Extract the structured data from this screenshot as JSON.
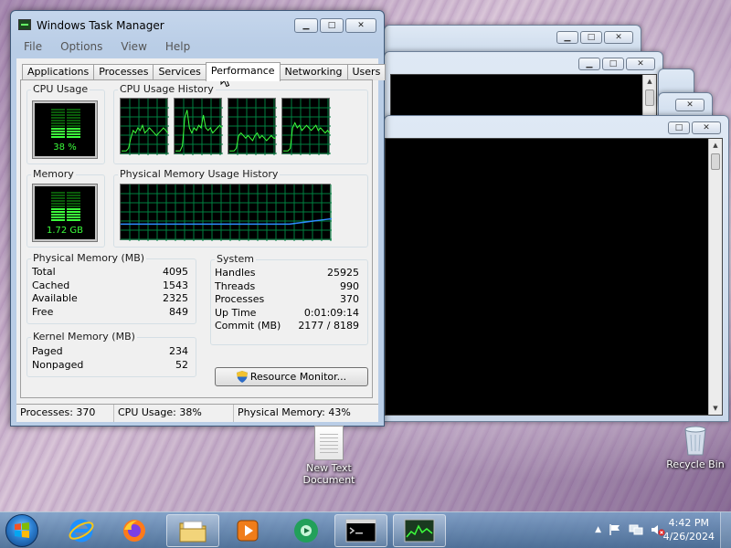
{
  "task_manager": {
    "title": "Windows Task Manager",
    "menu": [
      "File",
      "Options",
      "View",
      "Help"
    ],
    "tabs": [
      "Applications",
      "Processes",
      "Services",
      "Performance",
      "Networking",
      "Users"
    ],
    "active_tab": "Performance",
    "performance": {
      "cpu_usage_title": "CPU Usage",
      "cpu_usage_value": "38 %",
      "cpu_usage_fraction": 0.38,
      "cpu_history_title": "CPU Usage History",
      "memory_title": "Memory",
      "memory_value": "1.72 GB",
      "memory_fraction": 0.43,
      "memory_history_title": "Physical Memory Usage History",
      "physical_memory": {
        "title": "Physical Memory (MB)",
        "rows": [
          {
            "label": "Total",
            "value": "4095"
          },
          {
            "label": "Cached",
            "value": "1543"
          },
          {
            "label": "Available",
            "value": "2325"
          },
          {
            "label": "Free",
            "value": "849"
          }
        ]
      },
      "kernel_memory": {
        "title": "Kernel Memory (MB)",
        "rows": [
          {
            "label": "Paged",
            "value": "234"
          },
          {
            "label": "Nonpaged",
            "value": "52"
          }
        ]
      },
      "system": {
        "title": "System",
        "rows": [
          {
            "label": "Handles",
            "value": "25925"
          },
          {
            "label": "Threads",
            "value": "990"
          },
          {
            "label": "Processes",
            "value": "370"
          },
          {
            "label": "Up Time",
            "value": "0:01:09:14"
          },
          {
            "label": "Commit (MB)",
            "value": "2177 / 8189"
          }
        ]
      },
      "resource_monitor_label": "Resource Monitor..."
    },
    "status": {
      "processes": "Processes: 370",
      "cpu": "CPU Usage: 38%",
      "memory": "Physical Memory: 43%"
    }
  },
  "desktop": {
    "icons": [
      {
        "label_line1": "New Text",
        "label_line2": "Document",
        "icon": "text-document-icon"
      },
      {
        "label_line1": "Recycle Bin",
        "label_line2": "",
        "icon": "recycle-bin-icon"
      }
    ]
  },
  "taskbar": {
    "pinned": [
      "internet-explorer-icon",
      "firefox-icon",
      "file-explorer-icon",
      "media-player-icon",
      "media-center-icon",
      "command-prompt-icon",
      "task-manager-icon"
    ],
    "clock_time": "4:42 PM",
    "clock_date": "4/26/2024",
    "colors": {
      "accent": "#3a6ea5",
      "graph_green": "#3cff3c",
      "graph_grid": "#008040"
    }
  }
}
